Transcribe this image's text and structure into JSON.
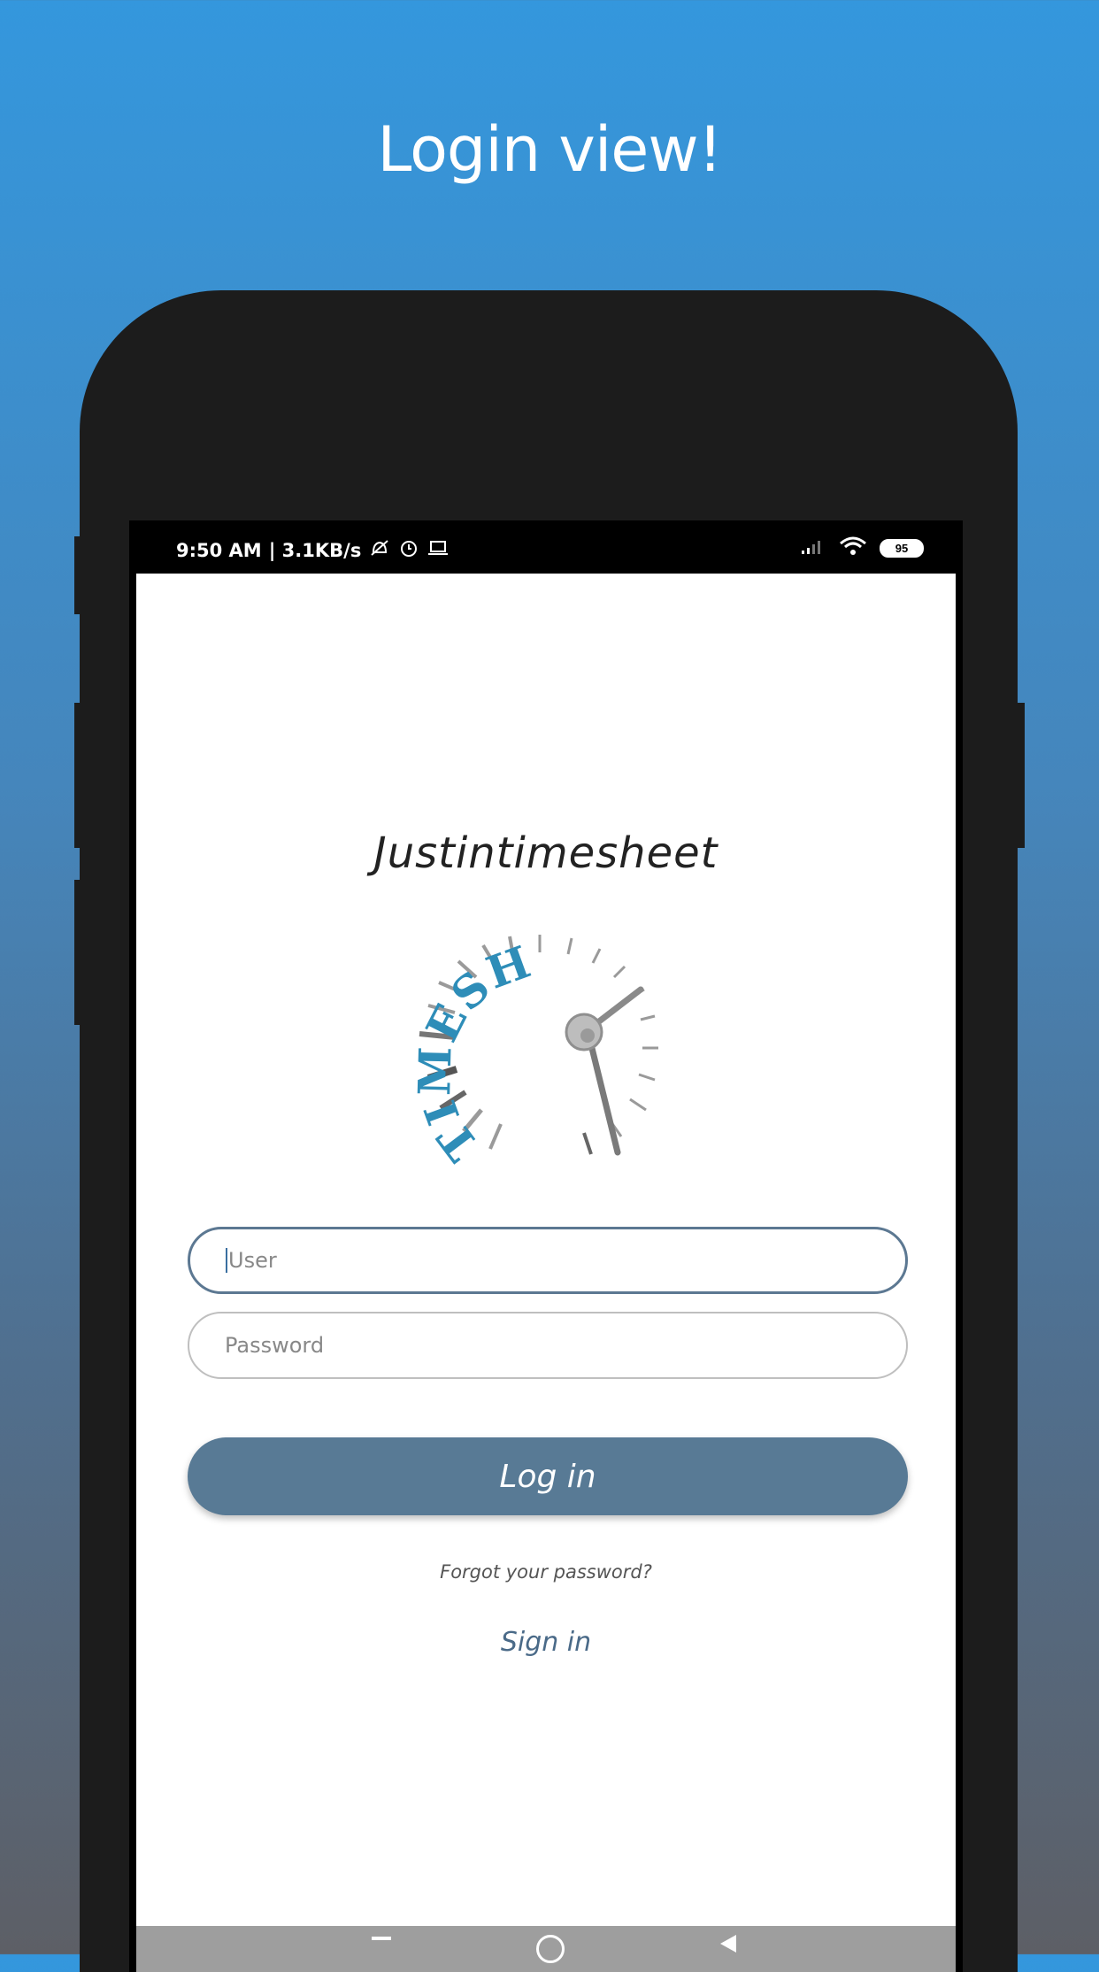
{
  "headline": "Login view!",
  "status_bar": {
    "time": "9:50 AM",
    "speed": "| 3.1KB/s",
    "battery": "95"
  },
  "app": {
    "brand": "Justintimesheet",
    "logo_text": "TIMESHEET",
    "user_placeholder": "User",
    "password_placeholder": "Password",
    "login_label": "Log in",
    "forgot_label": "Forgot your password?",
    "signin_label": "Sign in"
  },
  "colors": {
    "accent": "#587A95",
    "background_top": "#3497DD",
    "background_bottom": "#5D5F66",
    "logo_text": "#2E8DB8"
  }
}
